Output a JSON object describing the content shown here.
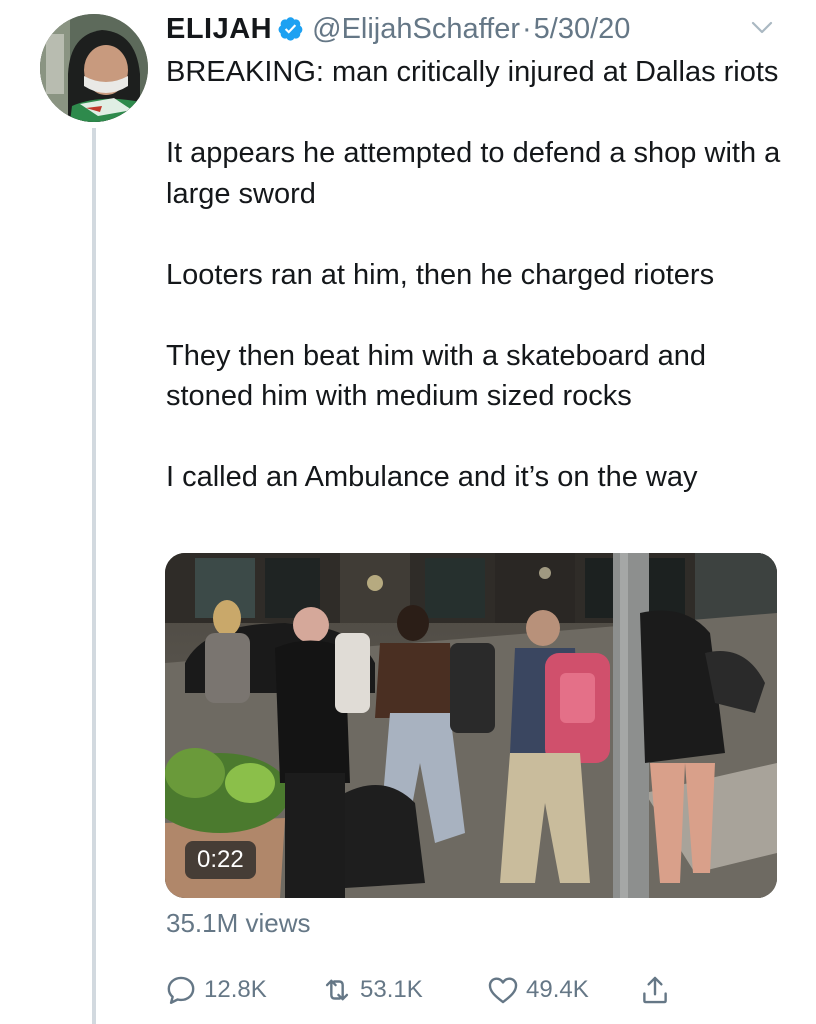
{
  "tweet": {
    "author_name": "ELIJAH",
    "handle": "@ElijahSchaffer",
    "separator": "·",
    "date": "5/30/20",
    "text": "BREAKING: man critically injured at Dallas riots\n\nIt appears he attempted to defend a shop with a large sword\n\nLooters ran at him, then he charged rioters\n\nThey then beat him with a skateboard and stoned him with medium sized rocks\n\nI called an Ambulance and it’s on the way",
    "media": {
      "type": "video",
      "duration": "0:22"
    },
    "views": "35.1M views",
    "actions": {
      "reply_count": "12.8K",
      "retweet_count": "53.1K",
      "like_count": "49.4K"
    }
  },
  "icons": {
    "verified": "verified-badge-icon",
    "caret": "chevron-down-icon",
    "reply": "reply-icon",
    "retweet": "retweet-icon",
    "like": "heart-icon",
    "share": "share-icon"
  },
  "colors": {
    "verified_blue": "#1da1f2",
    "text_primary": "#14171a",
    "text_secondary": "#657786",
    "thread_line": "#d2d9df"
  }
}
